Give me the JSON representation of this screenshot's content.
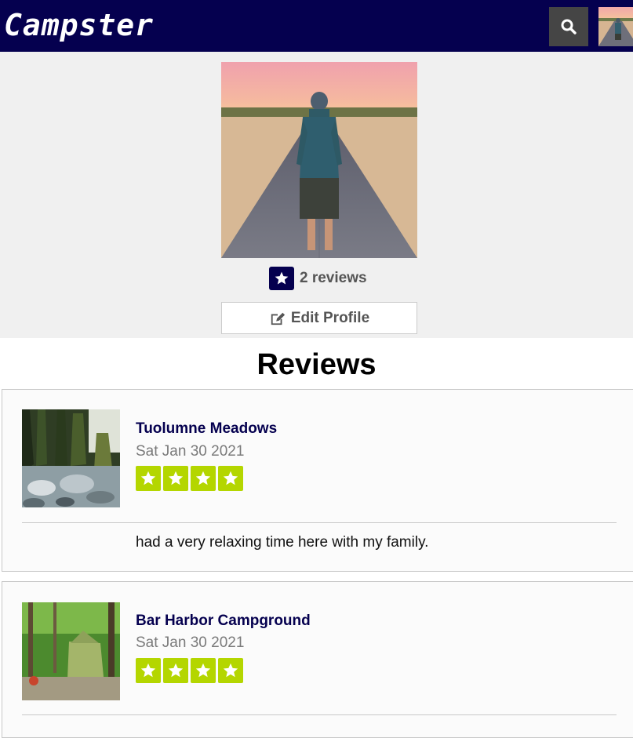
{
  "navbar": {
    "brand": "Campster",
    "search_icon": "search-icon",
    "avatar_icon": "avatar"
  },
  "profile": {
    "review_count": "2 reviews",
    "edit_label": "Edit Profile",
    "star_icon": "star-icon",
    "edit_icon": "edit-icon"
  },
  "reviews": {
    "heading": "Reviews",
    "items": [
      {
        "title": "Tuolumne Meadows",
        "date": "Sat Jan 30 2021",
        "rating": 4,
        "text": "had a very relaxing time here with my family."
      },
      {
        "title": "Bar Harbor Campground",
        "date": "Sat Jan 30 2021",
        "rating": 4,
        "text": ""
      }
    ]
  },
  "colors": {
    "navbar_bg": "#05004f",
    "star_green": "#b4d600",
    "profile_bg": "#f0f0f0",
    "search_bg": "#454545"
  }
}
